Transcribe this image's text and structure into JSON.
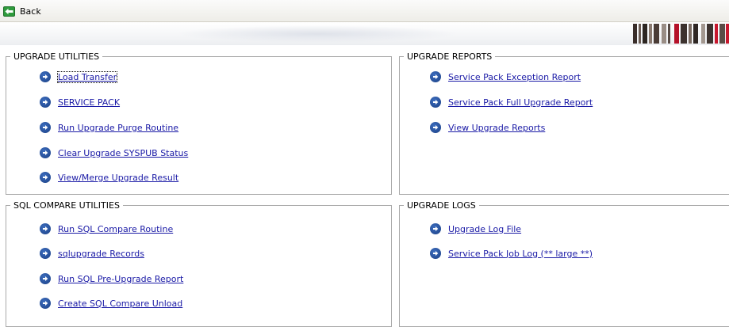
{
  "toolbar": {
    "back_label": "Back"
  },
  "sections": {
    "upgrade_utilities": {
      "title": "UPGRADE UTILITIES",
      "links": [
        "Load Transfer",
        "SERVICE PACK",
        "Run Upgrade Purge Routine",
        "Clear Upgrade SYSPUB Status",
        "View/Merge Upgrade Result"
      ]
    },
    "upgrade_reports": {
      "title": "UPGRADE REPORTS",
      "links": [
        "Service Pack Exception Report",
        "Service Pack Full Upgrade Report",
        "View Upgrade Reports"
      ]
    },
    "sql_compare": {
      "title": "SQL COMPARE UTILITIES",
      "links": [
        "Run SQL Compare Routine",
        "sqlupgrade Records",
        "Run SQL Pre-Upgrade Report",
        "Create SQL Compare Unload"
      ]
    },
    "upgrade_logs": {
      "title": "UPGRADE LOGS",
      "links": [
        "Upgrade Log File",
        "Service Pack Job Log (** large **)"
      ]
    }
  },
  "colors": {
    "link": "#1a1aa6",
    "arrow_icon": "#1f4a96",
    "back_icon": "#2e9a3c",
    "border": "#a9a9a9"
  },
  "icons": {
    "back": "back-arrow-icon",
    "link": "arrow-right-circle-icon",
    "logo": "company-logo-icon"
  }
}
